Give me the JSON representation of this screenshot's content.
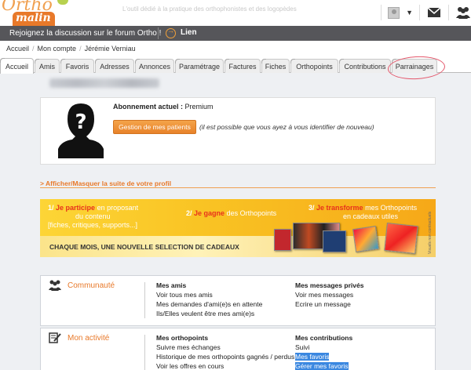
{
  "header": {
    "logo_top": "Ortho",
    "logo_bottom": "malin",
    "tagline": "L'outil dédié à la pratique des orthophonistes et des logopèdes",
    "user_menu_caret": "▼"
  },
  "darkbar": {
    "forum_text": "Rejoignez la discussion sur le forum Ortho !",
    "lien_label": "Lien"
  },
  "breadcrumb": [
    "Accueil",
    "Mon compte",
    "Jérémie Verniau"
  ],
  "tabs": [
    {
      "label": "Accueil",
      "active": true
    },
    {
      "label": "Amis"
    },
    {
      "label": "Favoris"
    },
    {
      "label": "Adresses"
    },
    {
      "label": "Annonces"
    },
    {
      "label": "Paramétrage"
    },
    {
      "label": "Factures"
    },
    {
      "label": "Fiches"
    },
    {
      "label": "Orthopoints"
    },
    {
      "label": "Contributions"
    },
    {
      "label": "Parrainages"
    }
  ],
  "profile": {
    "abo_label": "Abonnement actuel :",
    "abo_value": "Premium",
    "gestion_button": "Gestion de mes patients",
    "gestion_note": "(il est possible que vous ayez à vous identifier de nouveau)"
  },
  "toggle_profile": "> Afficher/Masquer la suite de votre profil",
  "banner": {
    "step1_num": "1/",
    "step1_hi": "Je participe",
    "step1_rest": "en proposant",
    "step1_line2": "du contenu",
    "step1_line3": "[fiches, critiques, supports...]",
    "step2_num": "2/",
    "step2_hi": "Je gagne",
    "step2_rest": "des Orthopoints",
    "step3_num": "3/",
    "step3_hi": "Je transforme",
    "step3_rest": "mes Orthopoints",
    "step3_line2": "en cadeaux utiles",
    "tagline": "CHAQUE MOIS, UNE NOUVELLE SELECTION DE CADEAUX",
    "vertical_note": "Visuels non contractuels"
  },
  "panels": {
    "communaute": {
      "title": "Communauté",
      "col1_head": "Mes amis",
      "col1_items": [
        "Voir tous mes amis",
        "Mes demandes d'ami(e)s en attente",
        "Ils/Elles veulent être mes ami(e)s"
      ],
      "col2_head": "Mes messages privés",
      "col2_items": [
        "Voir mes messages",
        "Ecrire un message"
      ]
    },
    "activite": {
      "title": "Mon activité",
      "col1_head": "Mes orthopoints",
      "col1_items": [
        "Suivre mes échanges",
        "Historique de mes orthopoints gagnés / perdus",
        "Voir les offres en cours"
      ],
      "col2_head": "Mes contributions",
      "col2_items": [
        "Suivi",
        "Mes favoris",
        "Gérer mes favoris"
      ]
    }
  },
  "colors": {
    "accent_orange": "#e8792a",
    "dark_bar": "#56565a",
    "highlight_red": "#e4566a",
    "selection_blue": "#3a87e0"
  }
}
